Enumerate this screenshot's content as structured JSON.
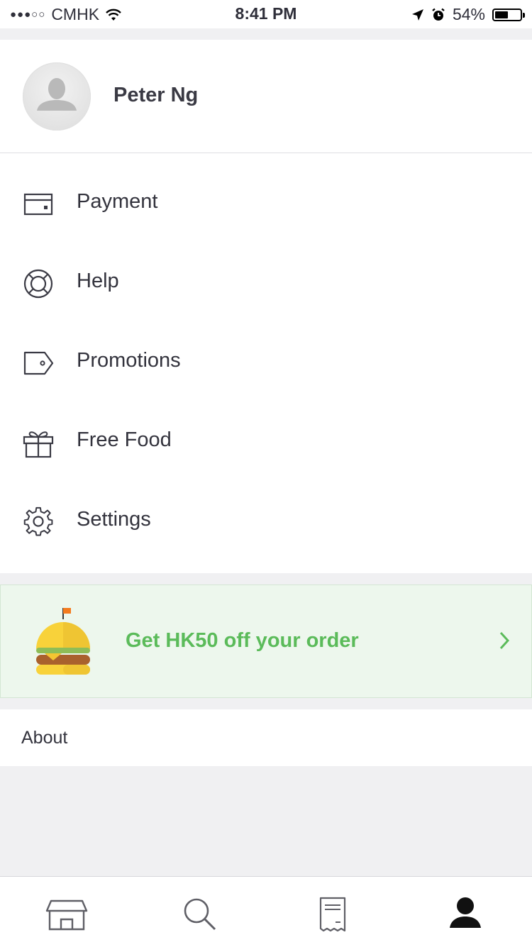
{
  "status_bar": {
    "carrier": "CMHK",
    "time": "8:41 PM",
    "battery": "54%",
    "battery_level": 0.54
  },
  "profile": {
    "name": "Peter Ng"
  },
  "menu": {
    "items": [
      {
        "label": "Payment",
        "icon": "card-icon"
      },
      {
        "label": "Help",
        "icon": "lifebuoy-icon"
      },
      {
        "label": "Promotions",
        "icon": "tag-icon"
      },
      {
        "label": "Free Food",
        "icon": "gift-icon"
      },
      {
        "label": "Settings",
        "icon": "gear-icon"
      }
    ]
  },
  "promo": {
    "text": "Get HK50 off your order",
    "color": "#5bbb5a"
  },
  "about": {
    "label": "About"
  },
  "tabbar": {
    "tabs": [
      "store-icon",
      "search-icon",
      "receipt-icon",
      "account-icon"
    ]
  }
}
